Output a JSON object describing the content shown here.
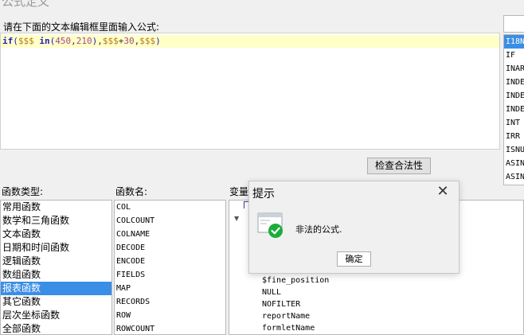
{
  "window": {
    "title": "公式定义"
  },
  "editor": {
    "prompt": "请在下面的文本编辑框里面输入公式:",
    "formula_tokens": {
      "kw_if": "if",
      "lparen": "(",
      "var1": "$$$",
      "space": " ",
      "kw_in": "in",
      "lparen2": "(",
      "num1": "450",
      "comma1": ",",
      "num2": "210",
      "rparen2": ")",
      "comma2": ",",
      "var2": "$$$",
      "plus": "+",
      "num3": "30",
      "comma3": ",",
      "var3": "$$$",
      "rparen": ")"
    }
  },
  "function_list": {
    "search_value": "",
    "items": [
      "I18N",
      "IF",
      "INAR",
      "INDE",
      "INDE",
      "INDE",
      "INT",
      "IRR",
      "ISNU",
      "ASIN",
      "ASIN"
    ],
    "selected_index": 0
  },
  "check_button": {
    "label": "检查合法性"
  },
  "labels": {
    "function_type": "函数类型:",
    "function_name": "函数名:",
    "variables": "变量"
  },
  "function_types": {
    "items": [
      "常用函数",
      "数学和三角函数",
      "文本函数",
      "日期和时间函数",
      "逻辑函数",
      "数组函数",
      "报表函数",
      "其它函数",
      "层次坐标函数",
      "全部函数"
    ],
    "selected_index": 6
  },
  "function_names": {
    "items": [
      "COL",
      "COLCOUNT",
      "COLNAME",
      "DECODE",
      "ENCODE",
      "FIELDS",
      "MAP",
      "RECORDS",
      "ROW",
      "ROWCOUNT"
    ]
  },
  "variables": {
    "items": [
      "$fine_position",
      "NULL",
      "NOFILTER",
      "reportName",
      "formletName"
    ]
  },
  "dialog": {
    "title": "提示",
    "close_glyph": "✕",
    "message": "非法的公式.",
    "ok_label": "确定",
    "icon": "window-check-icon",
    "colors": {
      "check": "#1aad3a",
      "window_frame": "#9aa6b2"
    }
  }
}
